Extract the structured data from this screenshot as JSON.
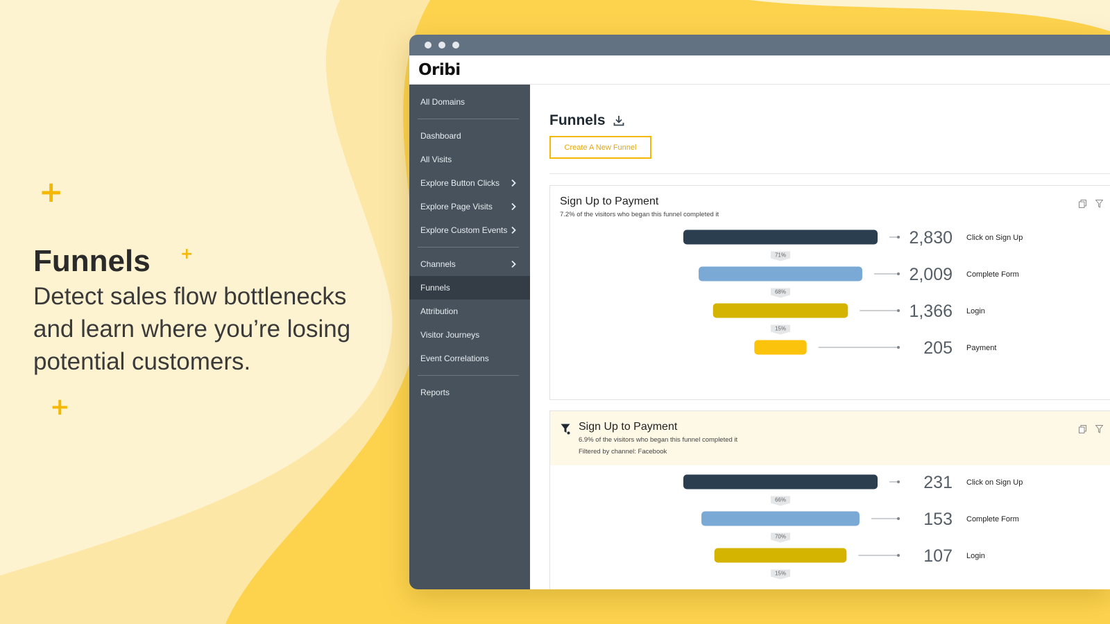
{
  "hero": {
    "title": "Funnels",
    "description": "Detect sales flow bottlenecks and learn where you’re losing potential customers."
  },
  "colors": {
    "accent": "#f5b800",
    "bar_1": "#2b3e50",
    "bar_2": "#7aa9d6",
    "bar_3": "#d4b400",
    "bar_4": "#fcc30c",
    "sidebar": "#47525c"
  },
  "app": {
    "logo": "Oribi"
  },
  "sidebar": {
    "items": [
      {
        "label": "All Domains",
        "chevron": false,
        "active": false
      },
      {
        "label": "Dashboard",
        "chevron": false,
        "active": false
      },
      {
        "label": "All Visits",
        "chevron": false,
        "active": false
      },
      {
        "label": "Explore Button Clicks",
        "chevron": true,
        "active": false
      },
      {
        "label": "Explore Page Visits",
        "chevron": true,
        "active": false
      },
      {
        "label": "Explore Custom Events",
        "chevron": true,
        "active": false
      },
      {
        "label": "Channels",
        "chevron": true,
        "active": false
      },
      {
        "label": "Funnels",
        "chevron": false,
        "active": true
      },
      {
        "label": "Attribution",
        "chevron": false,
        "active": false
      },
      {
        "label": "Visitor Journeys",
        "chevron": false,
        "active": false
      },
      {
        "label": "Event Correlations",
        "chevron": false,
        "active": false
      },
      {
        "label": "Reports",
        "chevron": false,
        "active": false
      }
    ]
  },
  "main": {
    "title": "Funnels",
    "create_button": "Create A New Funnel"
  },
  "funnels": [
    {
      "title": "Sign Up to Payment",
      "subtitle": "7.2% of the visitors who began this funnel completed it",
      "filter": "",
      "steps": [
        {
          "count": "2,830",
          "value": 2830,
          "label": "Click on Sign Up"
        },
        {
          "count": "2,009",
          "value": 2009,
          "label": "Complete Form"
        },
        {
          "count": "1,366",
          "value": 1366,
          "label": "Login"
        },
        {
          "count": "205",
          "value": 205,
          "label": "Payment"
        }
      ],
      "conversions": [
        "71%",
        "68%",
        "15%"
      ]
    },
    {
      "title": "Sign Up to Payment",
      "subtitle": "6.9% of the visitors who began this funnel completed it",
      "filter": "Filtered by channel: Facebook",
      "steps": [
        {
          "count": "231",
          "value": 231,
          "label": "Click on Sign Up"
        },
        {
          "count": "153",
          "value": 153,
          "label": "Complete Form"
        },
        {
          "count": "107",
          "value": 107,
          "label": "Login"
        }
      ],
      "conversions": [
        "66%",
        "70%",
        "15%"
      ]
    }
  ]
}
